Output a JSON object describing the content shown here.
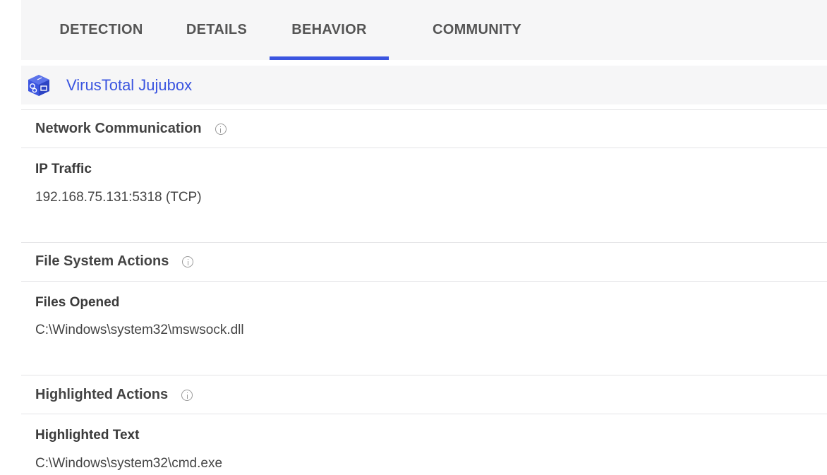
{
  "tabs": {
    "detection": "DETECTION",
    "details": "DETAILS",
    "behavior": "BEHAVIOR",
    "community": "COMMUNITY",
    "active": "BEHAVIOR"
  },
  "sandbox": {
    "name": "VirusTotal Jujubox",
    "icon": "sandbox-box-icon"
  },
  "sections": {
    "network": {
      "title": "Network Communication",
      "subtitle": "IP Traffic",
      "value": "192.168.75.131:5318 (TCP)"
    },
    "filesystem": {
      "title": "File System Actions",
      "subtitle": "Files Opened",
      "value": "C:\\Windows\\system32\\mswsock.dll"
    },
    "highlighted": {
      "title": "Highlighted Actions",
      "subtitle": "Highlighted Text",
      "value": "C:\\Windows\\system32\\cmd.exe"
    }
  },
  "colors": {
    "accent": "#3b55e0",
    "tab_background": "#f6f6f7",
    "divider": "#e4e4e6"
  }
}
